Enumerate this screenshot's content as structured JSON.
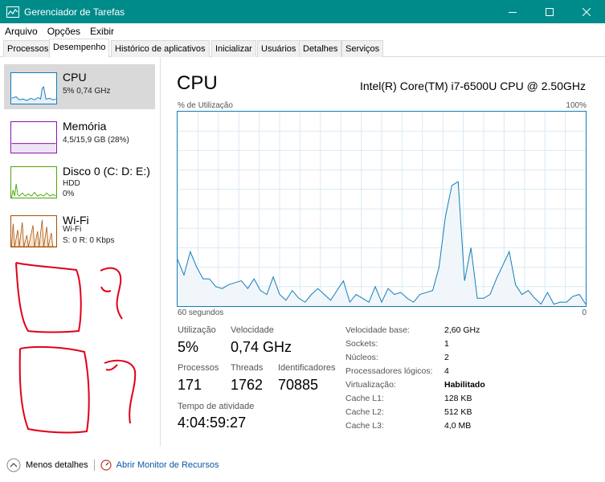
{
  "window": {
    "title": "Gerenciador de Tarefas"
  },
  "menu": [
    "Arquivo",
    "Opções",
    "Exibir"
  ],
  "tabs": [
    "Processos",
    "Desempenho",
    "Histórico de aplicativos",
    "Inicializar",
    "Usuários",
    "Detalhes",
    "Serviços"
  ],
  "sidebar": {
    "items": [
      {
        "name": "CPU",
        "sub1": "5%  0,74 GHz"
      },
      {
        "name": "Memória",
        "sub1": "4,5/15,9 GB (28%)"
      },
      {
        "name": "Disco 0 (C: D: E:)",
        "sub1": "HDD",
        "sub2": "0%"
      },
      {
        "name": "Wi-Fi",
        "sub1": "Wi-Fi",
        "sub2": "S: 0 R: 0 Kbps"
      }
    ]
  },
  "main": {
    "title": "CPU",
    "model": "Intel(R) Core(TM) i7-6500U CPU @ 2.50GHz",
    "graph": {
      "ylabel": "% de Utilização",
      "ymax_label": "100%",
      "xlabel": "60 segundos",
      "xmin_label": "0",
      "values": [
        24,
        16,
        28,
        20,
        14,
        14,
        10,
        9,
        11,
        12,
        13,
        9,
        14,
        8,
        6,
        15,
        6,
        3,
        8,
        4,
        2,
        6,
        9,
        6,
        3,
        8,
        13,
        2,
        6,
        4,
        2,
        10,
        2,
        9,
        6,
        7,
        4,
        2,
        6,
        7,
        8,
        20,
        46,
        62,
        64,
        13,
        30,
        4,
        4,
        6,
        14,
        21,
        28,
        11,
        6,
        8,
        4,
        1,
        7,
        1,
        2,
        2,
        5,
        6,
        1
      ],
      "line_color": "#117dbb",
      "fill_color": "#f1f6fa"
    },
    "stats": {
      "utilizacao_label": "Utilização",
      "utilizacao": "5%",
      "velocidade_label": "Velocidade",
      "velocidade": "0,74 GHz",
      "processos_label": "Processos",
      "processos": "171",
      "threads_label": "Threads",
      "threads": "1762",
      "identificadores_label": "Identificadores",
      "identificadores": "70885",
      "tempo_label": "Tempo de atividade",
      "tempo": "4:04:59:27"
    },
    "info": [
      {
        "label": "Velocidade base:",
        "value": "2,60 GHz"
      },
      {
        "label": "Sockets:",
        "value": "1"
      },
      {
        "label": "Núcleos:",
        "value": "2"
      },
      {
        "label": "Processadores lógicos:",
        "value": "4"
      },
      {
        "label": "Virtualização:",
        "value": "Habilitado"
      },
      {
        "label": "Cache L1:",
        "value": "128 KB"
      },
      {
        "label": "Cache L2:",
        "value": "512 KB"
      },
      {
        "label": "Cache L3:",
        "value": "4,0 MB"
      }
    ]
  },
  "footer": {
    "fewer_details": "Menos detalhes",
    "resource_monitor": "Abrir Monitor de Recursos"
  }
}
